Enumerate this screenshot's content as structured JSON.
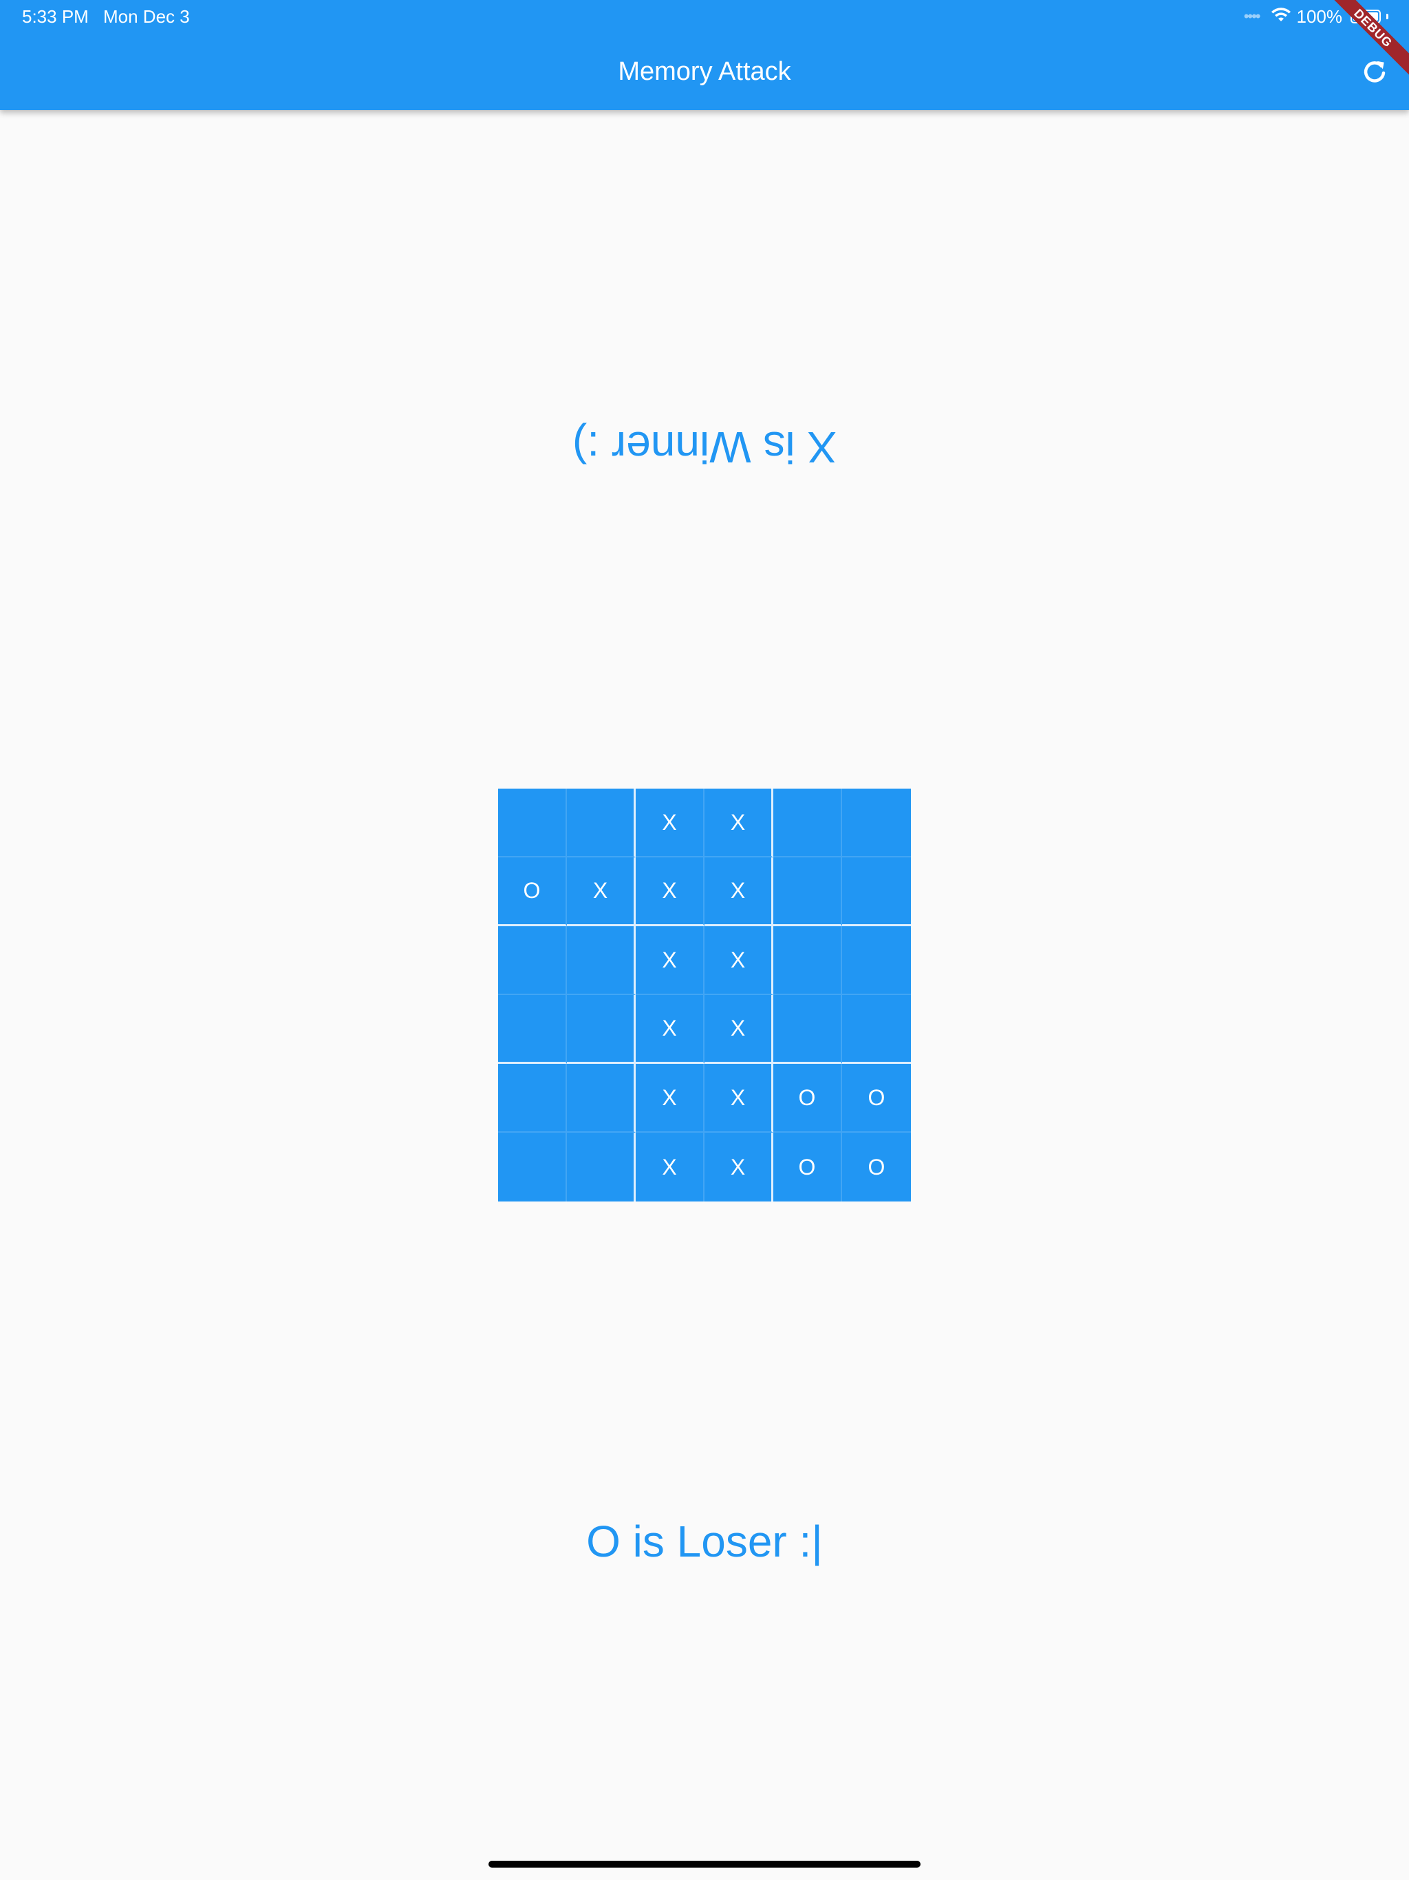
{
  "status_bar": {
    "time": "5:33 PM",
    "date": "Mon Dec 3",
    "battery_text": "100%",
    "battery_level": 1.0,
    "signal_icon": "signal-dots-icon",
    "wifi_icon": "wifi-icon"
  },
  "app_bar": {
    "title": "Memory Attack",
    "refresh_icon": "refresh-icon",
    "color": "#2196F3"
  },
  "debug_banner": "DEBUG",
  "messages": {
    "winner": "X is Winner :)",
    "loser": "O is Loser :|",
    "color": "#2196F3"
  },
  "board": {
    "rows": [
      [
        "",
        "",
        "X",
        "X",
        "",
        ""
      ],
      [
        "O",
        "X",
        "X",
        "X",
        "",
        ""
      ],
      [
        "",
        "",
        "X",
        "X",
        "",
        ""
      ],
      [
        "",
        "",
        "X",
        "X",
        "",
        ""
      ],
      [
        "",
        "",
        "X",
        "X",
        "O",
        "O"
      ],
      [
        "",
        "",
        "X",
        "X",
        "O",
        "O"
      ]
    ],
    "color": "#2196F3"
  }
}
